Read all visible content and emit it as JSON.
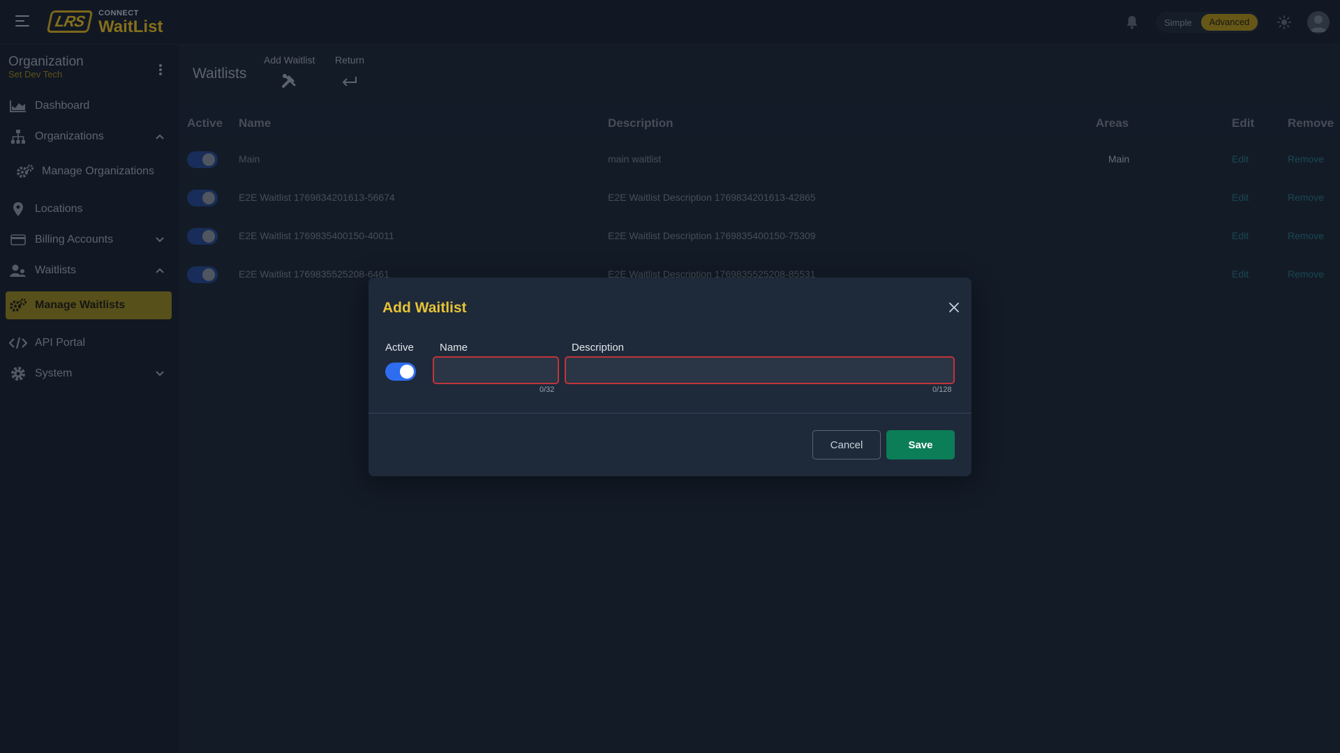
{
  "app": {
    "logo_badge": "LRS",
    "logo_connect": "CONNECT",
    "logo_name": "WaitList"
  },
  "topbar": {
    "mode_simple": "Simple",
    "mode_advanced": "Advanced",
    "active_mode": "Advanced"
  },
  "sidebar": {
    "org_title": "Organization",
    "org_subtitle": "Set Dev Tech",
    "items": [
      {
        "label": "Dashboard",
        "icon": "chart-area-icon"
      },
      {
        "label": "Organizations",
        "icon": "sitemap-icon",
        "expanded": true
      },
      {
        "label": "Manage Organizations",
        "icon": "gears-icon"
      },
      {
        "label": "Locations",
        "icon": "map-pin-icon"
      },
      {
        "label": "Billing Accounts",
        "icon": "credit-card-icon",
        "expanded": false
      },
      {
        "label": "Waitlists",
        "icon": "users-icon",
        "expanded": true
      },
      {
        "label": "Manage Waitlists",
        "icon": "gears-icon",
        "active": true
      },
      {
        "label": "API Portal",
        "icon": "code-icon"
      },
      {
        "label": "System",
        "icon": "gear-icon",
        "expanded": false
      }
    ]
  },
  "page": {
    "title": "Waitlists",
    "tools": {
      "add_label": "Add Waitlist",
      "return_label": "Return"
    }
  },
  "table": {
    "headers": {
      "active": "Active",
      "name": "Name",
      "description": "Description",
      "areas": "Areas",
      "edit": "Edit",
      "remove": "Remove"
    },
    "rows": [
      {
        "active": true,
        "name": "Main",
        "description": "main waitlist",
        "areas": "Main",
        "edit": "Edit",
        "remove": "Remove"
      },
      {
        "active": true,
        "name": "E2E Waitlist 1769834201613-56674",
        "description": "E2E Waitlist Description 1769834201613-42865",
        "areas": "",
        "edit": "Edit",
        "remove": "Remove"
      },
      {
        "active": true,
        "name": "E2E Waitlist 1769835400150-40011",
        "description": "E2E Waitlist Description 1769835400150-75309",
        "areas": "",
        "edit": "Edit",
        "remove": "Remove"
      },
      {
        "active": true,
        "name": "E2E Waitlist 1769835525208-6461",
        "description": "E2E Waitlist Description 1769835525208-85531",
        "areas": "",
        "edit": "Edit",
        "remove": "Remove"
      }
    ]
  },
  "modal": {
    "title": "Add Waitlist",
    "active_label": "Active",
    "active_on": true,
    "name_label": "Name",
    "name_value": "",
    "name_counter": "0/32",
    "description_label": "Description",
    "description_value": "",
    "description_counter": "0/128",
    "cancel_label": "Cancel",
    "save_label": "Save"
  },
  "colors": {
    "accent": "#e6c235",
    "brand": "#b4951f",
    "primary_toggle": "#2e6df0",
    "save": "#0b7e57",
    "error_border": "#c0353a",
    "background": "#17202e"
  }
}
